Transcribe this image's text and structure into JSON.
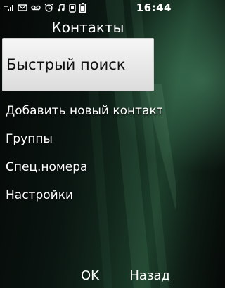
{
  "status": {
    "time": "16:44",
    "icons": [
      "signal-icon",
      "message-icon",
      "voicemail-icon",
      "alarm-icon",
      "music-note-icon",
      "silent-mode-icon",
      "battery-icon"
    ]
  },
  "screen": {
    "title": "Контакты"
  },
  "menu": {
    "selected": "Быстрый поиск",
    "items": [
      "Добавить новый контакт",
      "Группы",
      "Спец.номера",
      "Настройки"
    ]
  },
  "softkeys": {
    "left": "OK",
    "right": "Назад"
  }
}
